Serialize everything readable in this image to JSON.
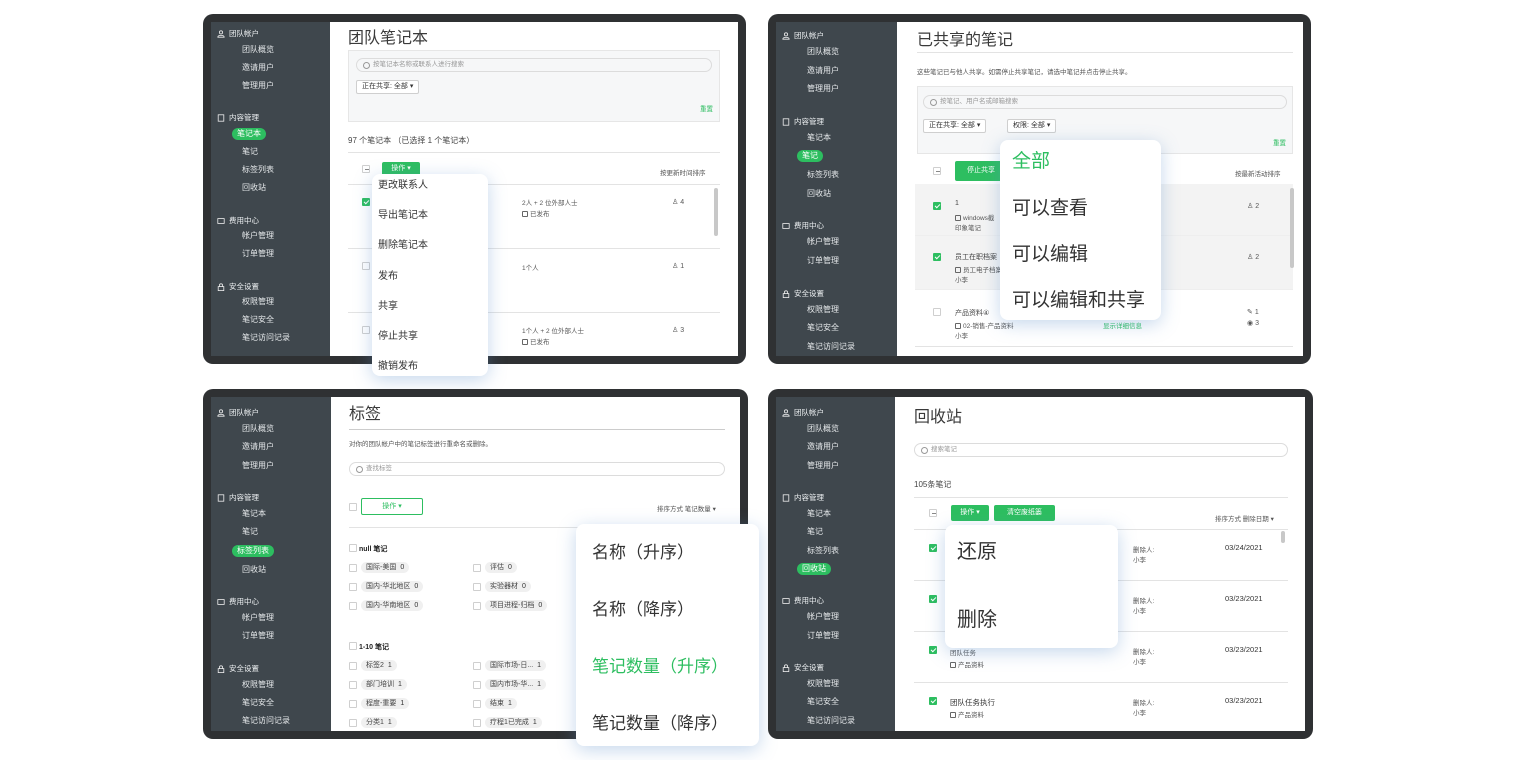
{
  "sidebar": {
    "team_account": "团队帐户",
    "team_overview": "团队概览",
    "invite_users": "邀请用户",
    "manage_users": "管理用户",
    "content_mgmt": "内容管理",
    "notebooks": "笔记本",
    "notes": "笔记",
    "tag_list": "标签列表",
    "trash": "回收站",
    "billing": "费用中心",
    "account_mgmt": "帐户管理",
    "order_mgmt": "订单管理",
    "security": "安全设置",
    "permissions": "权限管理",
    "note_security": "笔记安全",
    "access_log": "笔记访问记录"
  },
  "panel1": {
    "title": "团队笔记本",
    "search_placeholder": "按笔记本名称或联系人进行搜索",
    "filter": "正在共享: 全部",
    "reset": "重置",
    "count": "97 个笔记本 （已选择 1 个笔记本）",
    "action": "操作",
    "sort": "按更新时间排序",
    "rows": [
      {
        "members": "2人 + 2 位外部人士",
        "status": "已发布",
        "count": "4"
      },
      {
        "members": "1个人",
        "status": "",
        "count": "1"
      },
      {
        "members": "1个人 + 2 位外部人士",
        "status": "已发布",
        "count": "3"
      }
    ],
    "menu": [
      "更改联系人",
      "导出笔记本",
      "删除笔记本",
      "发布",
      "共享",
      "停止共享",
      "撤销发布"
    ]
  },
  "panel2": {
    "title": "已共享的笔记",
    "desc": "这些笔记已与他人共享。如需停止共享笔记，请选中笔记并点击停止共享。",
    "search_placeholder": "按笔记、用户名或邮箱搜索",
    "filter1": "正在共享: 全部",
    "filter2": "权限: 全部",
    "reset": "重置",
    "stop_share": "停止共享",
    "sort": "按最新活动排序",
    "rows": [
      {
        "title": "1",
        "sub": "windows截",
        "sub2": "印象笔记",
        "count": "2"
      },
      {
        "title": "员工在职档案",
        "sub": "员工电子档案",
        "sub2": "小李",
        "count": "2"
      },
      {
        "title": "产品资料④",
        "sub": "02-销售-产品资料",
        "sub2": "小李",
        "link": "显示详细信息",
        "count": "1",
        "count2": "3"
      }
    ],
    "menu": [
      "全部",
      "可以查看",
      "可以编辑",
      "可以编辑和共享"
    ]
  },
  "panel3": {
    "title": "标签",
    "desc": "对你的团队帐户中的笔记标签进行重命名或删除。",
    "search_placeholder": "查找标签",
    "action": "操作",
    "sort": "排序方式  笔记数量",
    "group1": "null 笔记",
    "group2": "1-10 笔记",
    "tags1": [
      {
        "name": "国际-美国",
        "n": "0"
      },
      {
        "name": "评估",
        "n": "0"
      },
      {
        "name": "国内-华北地区",
        "n": "0"
      },
      {
        "name": "实验器材",
        "n": "0"
      },
      {
        "name": "国内-华南地区",
        "n": "0"
      },
      {
        "name": "项目进程-归档",
        "n": "0"
      }
    ],
    "tags2": [
      {
        "name": "标签2",
        "n": "1"
      },
      {
        "name": "国际市场-日...",
        "n": "1"
      },
      {
        "name": "部门培训",
        "n": "1"
      },
      {
        "name": "国内市场-华...",
        "n": "1"
      },
      {
        "name": "程度-重要",
        "n": "1"
      },
      {
        "name": "结束",
        "n": "1"
      },
      {
        "name": "分类1",
        "n": "1"
      },
      {
        "name": "疗程1已完成",
        "n": "1"
      }
    ],
    "menu": [
      "名称（升序）",
      "名称（降序）",
      "笔记数量（升序）",
      "笔记数量（降序）"
    ]
  },
  "panel4": {
    "title": "回收站",
    "search_placeholder": "搜索笔记",
    "count": "105条笔记",
    "action": "操作",
    "empty": "清空废纸篓",
    "sort": "排序方式  删除日期",
    "rows": [
      {
        "title": "",
        "sub": "",
        "deleter_label": "删除人:",
        "deleter": "小李",
        "date": "03/24/2021"
      },
      {
        "title": "",
        "sub": "",
        "deleter_label": "删除人:",
        "deleter": "小李",
        "date": "03/23/2021"
      },
      {
        "title": "团队任务",
        "sub": "产品资料",
        "deleter_label": "删除人:",
        "deleter": "小李",
        "date": "03/23/2021"
      },
      {
        "title": "团队任务执行",
        "sub": "产品资料",
        "deleter_label": "删除人:",
        "deleter": "小李",
        "date": "03/23/2021"
      }
    ],
    "menu": [
      "还原",
      "删除"
    ]
  },
  "colors": {
    "accent": "#2dbe60",
    "sidebar": "#3f474d",
    "frame": "#2f3133"
  }
}
